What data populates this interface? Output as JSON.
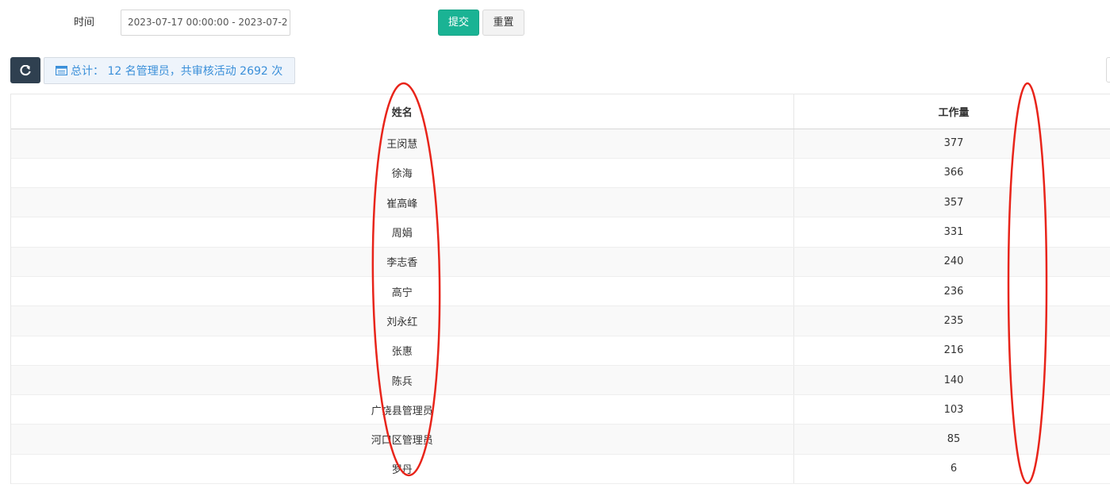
{
  "filter": {
    "time_label": "时间",
    "time_value": "2023-07-17 00:00:00 - 2023-07-2",
    "submit_label": "提交",
    "reset_label": "重置"
  },
  "toolbar": {
    "refresh_icon": "refresh-icon",
    "summary_icon": "list-icon",
    "summary_text": "总计： 12 名管理员，共审核活动 2692 次"
  },
  "table": {
    "headers": [
      "姓名",
      "工作量"
    ],
    "rows": [
      {
        "name": "王闵慧",
        "count": "377"
      },
      {
        "name": "徐海",
        "count": "366"
      },
      {
        "name": "崔高峰",
        "count": "357"
      },
      {
        "name": "周娟",
        "count": "331"
      },
      {
        "name": "李志香",
        "count": "240"
      },
      {
        "name": "高宁",
        "count": "236"
      },
      {
        "name": "刘永红",
        "count": "235"
      },
      {
        "name": "张惠",
        "count": "216"
      },
      {
        "name": "陈兵",
        "count": "140"
      },
      {
        "name": "广饶县管理员",
        "count": "103"
      },
      {
        "name": "河口区管理员",
        "count": "85"
      },
      {
        "name": "罗丹",
        "count": "6"
      }
    ]
  },
  "colors": {
    "accent_green": "#1ab394",
    "dark_button": "#2f4050",
    "annotation_red": "#e8241a"
  }
}
